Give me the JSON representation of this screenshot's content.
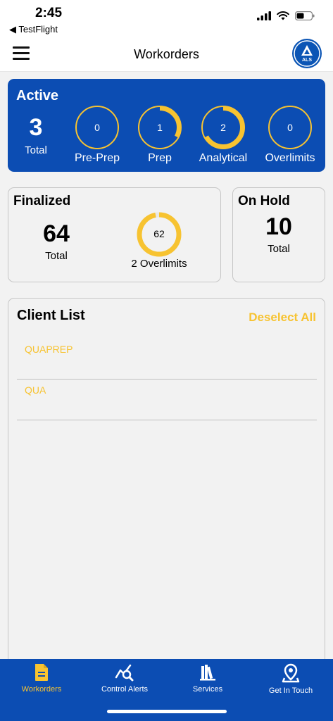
{
  "status_bar": {
    "time": "2:45",
    "back_label": "◀ TestFlight"
  },
  "nav": {
    "title": "Workorders",
    "logo_text": "ALS"
  },
  "active": {
    "title": "Active",
    "total": "3",
    "total_label": "Total",
    "stages": [
      {
        "label": "Pre-Prep",
        "value": "0",
        "progress": 0
      },
      {
        "label": "Prep",
        "value": "1",
        "progress": 0.33
      },
      {
        "label": "Analytical",
        "value": "2",
        "progress": 0.67
      },
      {
        "label": "Overlimits",
        "value": "0",
        "progress": 0
      }
    ]
  },
  "finalized": {
    "title": "Finalized",
    "total": "64",
    "total_label": "Total",
    "ring_value": "62",
    "ring_progress": 0.97,
    "overlimits_label": "2 Overlimits"
  },
  "on_hold": {
    "title": "On Hold",
    "total": "10",
    "total_label": "Total"
  },
  "client_list": {
    "title": "Client List",
    "deselect_label": "Deselect All",
    "items": [
      "QUAPREP",
      "QUA"
    ]
  },
  "tabs": [
    {
      "label": "Workorders",
      "icon": "document-icon",
      "active": true
    },
    {
      "label": "Control Alerts",
      "icon": "chart-search-icon",
      "active": false
    },
    {
      "label": "Services",
      "icon": "books-icon",
      "active": false
    },
    {
      "label": "Get In Touch",
      "icon": "location-pin-icon",
      "active": false
    }
  ],
  "colors": {
    "brand_blue": "#0c4db3",
    "accent_yellow": "#f7c331",
    "panel_gray": "#f2f2f2"
  }
}
